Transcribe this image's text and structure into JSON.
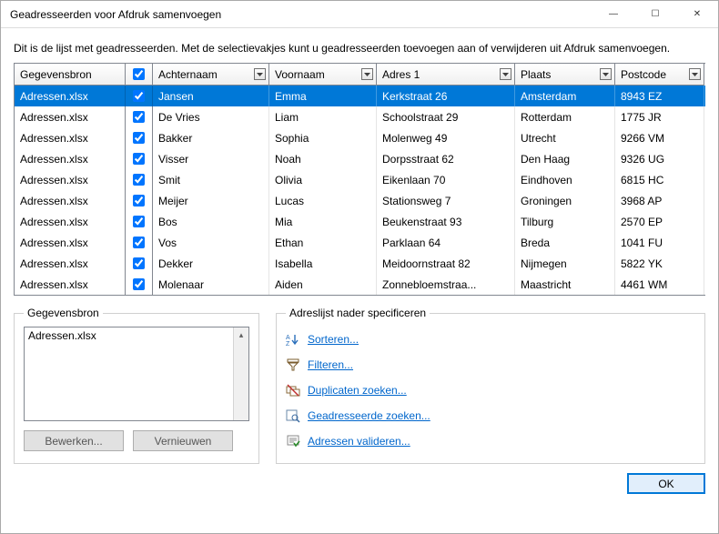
{
  "window": {
    "title": "Geadresseerden voor Afdruk samenvoegen"
  },
  "intro": "Dit is de lijst met geadresseerden. Met de selectievakjes kunt u geadresseerden toevoegen aan of verwijderen uit Afdruk samenvoegen.",
  "columns": {
    "source": "Gegevensbron",
    "lastname": "Achternaam",
    "firstname": "Voornaam",
    "addr1": "Adres 1",
    "city": "Plaats",
    "postcode": "Postcode"
  },
  "rows": [
    {
      "source": "Adressen.xlsx",
      "checked": true,
      "last": "Jansen",
      "first": "Emma",
      "addr": "Kerkstraat 26",
      "city": "Amsterdam",
      "post": "8943 EZ",
      "selected": true
    },
    {
      "source": "Adressen.xlsx",
      "checked": true,
      "last": "De Vries",
      "first": "Liam",
      "addr": "Schoolstraat 29",
      "city": "Rotterdam",
      "post": "1775 JR"
    },
    {
      "source": "Adressen.xlsx",
      "checked": true,
      "last": "Bakker",
      "first": "Sophia",
      "addr": "Molenweg 49",
      "city": "Utrecht",
      "post": "9266 VM"
    },
    {
      "source": "Adressen.xlsx",
      "checked": true,
      "last": "Visser",
      "first": "Noah",
      "addr": "Dorpsstraat 62",
      "city": "Den Haag",
      "post": "9326 UG"
    },
    {
      "source": "Adressen.xlsx",
      "checked": true,
      "last": "Smit",
      "first": "Olivia",
      "addr": "Eikenlaan 70",
      "city": "Eindhoven",
      "post": "6815 HC"
    },
    {
      "source": "Adressen.xlsx",
      "checked": true,
      "last": "Meijer",
      "first": "Lucas",
      "addr": "Stationsweg 7",
      "city": "Groningen",
      "post": "3968 AP"
    },
    {
      "source": "Adressen.xlsx",
      "checked": true,
      "last": "Bos",
      "first": "Mia",
      "addr": "Beukenstraat 93",
      "city": "Tilburg",
      "post": "2570 EP"
    },
    {
      "source": "Adressen.xlsx",
      "checked": true,
      "last": "Vos",
      "first": "Ethan",
      "addr": "Parklaan 64",
      "city": "Breda",
      "post": "1041 FU"
    },
    {
      "source": "Adressen.xlsx",
      "checked": true,
      "last": "Dekker",
      "first": "Isabella",
      "addr": "Meidoornstraat 82",
      "city": "Nijmegen",
      "post": "5822 YK"
    },
    {
      "source": "Adressen.xlsx",
      "checked": true,
      "last": "Molenaar",
      "first": "Aiden",
      "addr": "Zonnebloemstraa...",
      "city": "Maastricht",
      "post": "4461 WM"
    }
  ],
  "sourcePanel": {
    "legend": "Gegevensbron",
    "item": "Adressen.xlsx",
    "edit": "Bewerken...",
    "refresh": "Vernieuwen"
  },
  "refinePanel": {
    "legend": "Adreslijst nader specificeren",
    "sort": "Sorteren...",
    "filter": "Filteren...",
    "dupes": "Duplicaten zoeken...",
    "findRecipient": "Geadresseerde zoeken...",
    "validate": "Adressen valideren..."
  },
  "ok": "OK"
}
